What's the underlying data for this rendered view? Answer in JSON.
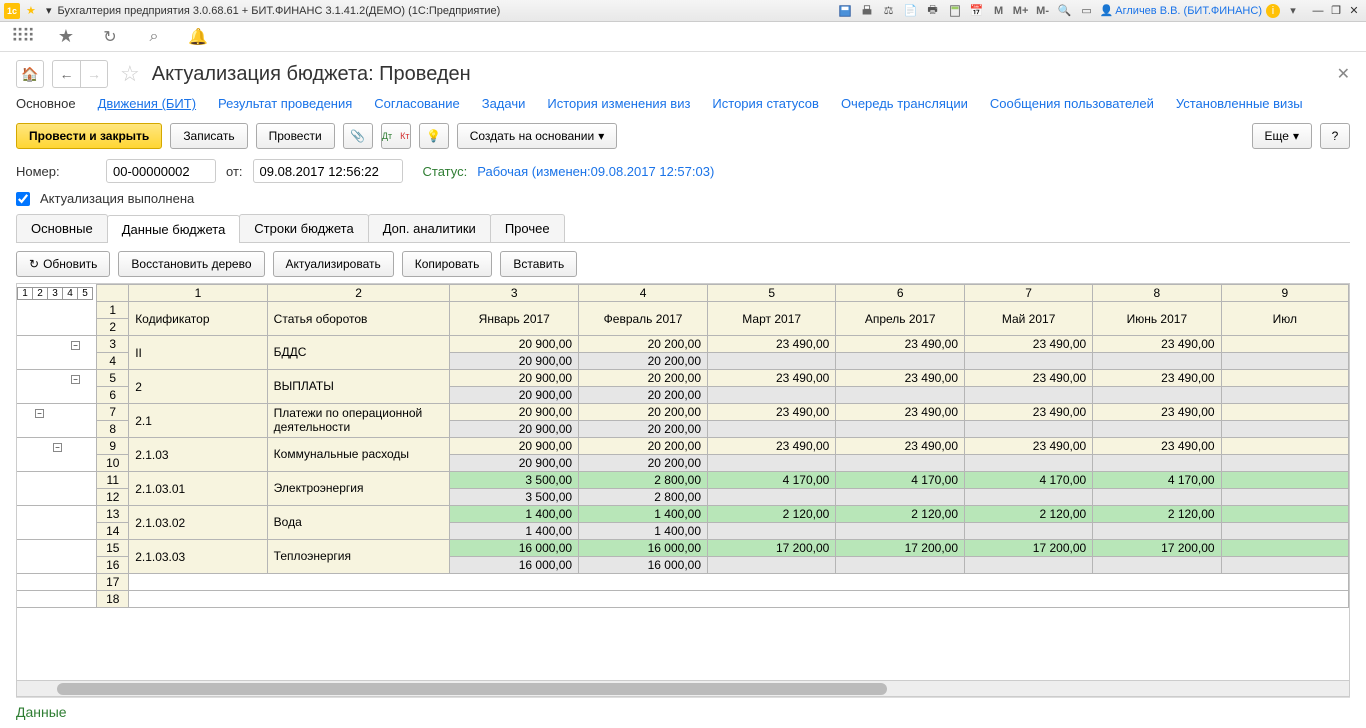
{
  "titlebar": {
    "title": "Бухгалтерия предприятия 3.0.68.61 + БИТ.ФИНАНС 3.1.41.2(ДЕМО)  (1С:Предприятие)",
    "user": "Агличев В.В. (БИТ.ФИНАНС)",
    "m": "M",
    "mp": "M+",
    "mm": "M-"
  },
  "doc": {
    "title": "Актуализация бюджета: Проведен"
  },
  "linkTabs": [
    "Основное",
    "Движения (БИТ)",
    "Результат проведения",
    "Согласование",
    "Задачи",
    "История изменения виз",
    "История статусов",
    "Очередь трансляции",
    "Сообщения пользователей",
    "Установленные визы"
  ],
  "actions": {
    "primary": "Провести и закрыть",
    "save": "Записать",
    "post": "Провести",
    "createBased": "Создать на основании",
    "more": "Еще"
  },
  "form": {
    "numberLabel": "Номер:",
    "number": "00-00000002",
    "dateLabel": "от:",
    "date": "09.08.2017 12:56:22",
    "statusLabel": "Статус:",
    "statusValue": "Рабочая (изменен:09.08.2017 12:57:03)",
    "actualDone": "Актуализация выполнена"
  },
  "subTabs": [
    "Основные",
    "Данные бюджета",
    "Строки бюджета",
    "Доп. аналитики",
    "Прочее"
  ],
  "gridActions": {
    "refresh": "Обновить",
    "restore": "Восстановить дерево",
    "actualize": "Актуализировать",
    "copy": "Копировать",
    "paste": "Вставить"
  },
  "levels": [
    "1",
    "2",
    "3",
    "4",
    "5"
  ],
  "colNums": [
    "1",
    "2",
    "3",
    "4",
    "5",
    "6",
    "7",
    "8",
    "9"
  ],
  "headers": {
    "codifier": "Кодификатор",
    "article": "Статья оборотов",
    "m1": "Январь 2017",
    "m2": "Февраль 2017",
    "m3": "Март 2017",
    "m4": "Апрель 2017",
    "m5": "Май 2017",
    "m6": "Июнь 2017",
    "m7": "Июл"
  },
  "rows": [
    {
      "n1": "1",
      "n2": "2",
      "code": "",
      "art": ""
    },
    {
      "n1": "3",
      "n2": "4",
      "code": "II",
      "art": "БДДС",
      "v": [
        "20 900,00",
        "20 200,00",
        "23 490,00",
        "23 490,00",
        "23 490,00",
        "23 490,00"
      ],
      "v2": [
        "20 900,00",
        "20 200,00",
        "",
        "",
        "",
        ""
      ],
      "cls": "y",
      "cls2": "s"
    },
    {
      "n1": "5",
      "n2": "6",
      "code": "2",
      "art": "ВЫПЛАТЫ",
      "v": [
        "20 900,00",
        "20 200,00",
        "23 490,00",
        "23 490,00",
        "23 490,00",
        "23 490,00"
      ],
      "v2": [
        "20 900,00",
        "20 200,00",
        "",
        "",
        "",
        ""
      ],
      "cls": "y",
      "cls2": "s"
    },
    {
      "n1": "7",
      "n2": "8",
      "code": "2.1",
      "art": "Платежи по операционной деятельности",
      "v": [
        "20 900,00",
        "20 200,00",
        "23 490,00",
        "23 490,00",
        "23 490,00",
        "23 490,00"
      ],
      "v2": [
        "20 900,00",
        "20 200,00",
        "",
        "",
        "",
        ""
      ],
      "cls": "y",
      "cls2": "s"
    },
    {
      "n1": "9",
      "n2": "10",
      "code": "2.1.03",
      "art": "Коммунальные расходы",
      "v": [
        "20 900,00",
        "20 200,00",
        "23 490,00",
        "23 490,00",
        "23 490,00",
        "23 490,00"
      ],
      "v2": [
        "20 900,00",
        "20 200,00",
        "",
        "",
        "",
        ""
      ],
      "cls": "y",
      "cls2": "s"
    },
    {
      "n1": "11",
      "n2": "12",
      "code": "2.1.03.01",
      "art": "Электроэнергия",
      "v": [
        "3 500,00",
        "2 800,00",
        "4 170,00",
        "4 170,00",
        "4 170,00",
        "4 170,00"
      ],
      "v2": [
        "3 500,00",
        "2 800,00",
        "",
        "",
        "",
        ""
      ],
      "cls": "g",
      "cls2": "s"
    },
    {
      "n1": "13",
      "n2": "14",
      "code": "2.1.03.02",
      "art": "Вода",
      "v": [
        "1 400,00",
        "1 400,00",
        "2 120,00",
        "2 120,00",
        "2 120,00",
        "2 120,00"
      ],
      "v2": [
        "1 400,00",
        "1 400,00",
        "",
        "",
        "",
        ""
      ],
      "cls": "g",
      "cls2": "s"
    },
    {
      "n1": "15",
      "n2": "16",
      "code": "2.1.03.03",
      "art": "Теплоэнергия",
      "v": [
        "16 000,00",
        "16 000,00",
        "17 200,00",
        "17 200,00",
        "17 200,00",
        "17 200,00"
      ],
      "v2": [
        "16 000,00",
        "16 000,00",
        "",
        "",
        "",
        ""
      ],
      "cls": "g",
      "cls2": "s"
    },
    {
      "n1": "17",
      "n2": "18",
      "code": "",
      "art": ""
    }
  ],
  "footer": {
    "data": "Данные"
  }
}
